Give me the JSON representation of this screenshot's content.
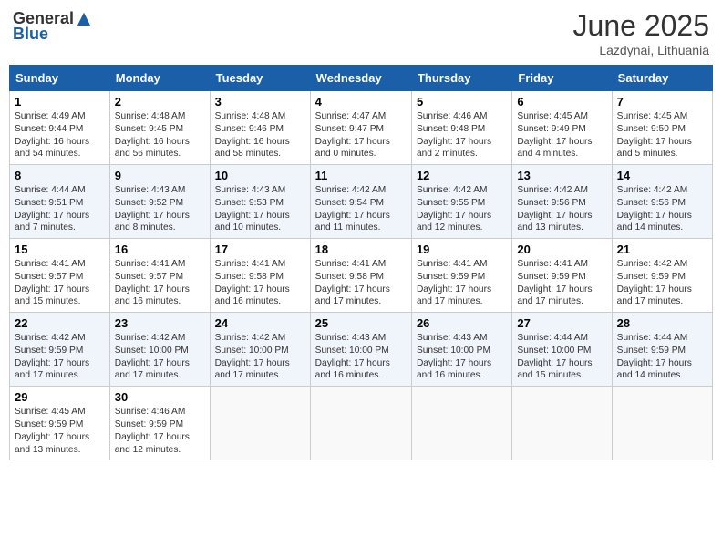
{
  "header": {
    "logo_general": "General",
    "logo_blue": "Blue",
    "month": "June 2025",
    "location": "Lazdynai, Lithuania"
  },
  "days_of_week": [
    "Sunday",
    "Monday",
    "Tuesday",
    "Wednesday",
    "Thursday",
    "Friday",
    "Saturday"
  ],
  "weeks": [
    [
      {
        "day": "1",
        "lines": [
          "Sunrise: 4:49 AM",
          "Sunset: 9:44 PM",
          "Daylight: 16 hours",
          "and 54 minutes."
        ]
      },
      {
        "day": "2",
        "lines": [
          "Sunrise: 4:48 AM",
          "Sunset: 9:45 PM",
          "Daylight: 16 hours",
          "and 56 minutes."
        ]
      },
      {
        "day": "3",
        "lines": [
          "Sunrise: 4:48 AM",
          "Sunset: 9:46 PM",
          "Daylight: 16 hours",
          "and 58 minutes."
        ]
      },
      {
        "day": "4",
        "lines": [
          "Sunrise: 4:47 AM",
          "Sunset: 9:47 PM",
          "Daylight: 17 hours",
          "and 0 minutes."
        ]
      },
      {
        "day": "5",
        "lines": [
          "Sunrise: 4:46 AM",
          "Sunset: 9:48 PM",
          "Daylight: 17 hours",
          "and 2 minutes."
        ]
      },
      {
        "day": "6",
        "lines": [
          "Sunrise: 4:45 AM",
          "Sunset: 9:49 PM",
          "Daylight: 17 hours",
          "and 4 minutes."
        ]
      },
      {
        "day": "7",
        "lines": [
          "Sunrise: 4:45 AM",
          "Sunset: 9:50 PM",
          "Daylight: 17 hours",
          "and 5 minutes."
        ]
      }
    ],
    [
      {
        "day": "8",
        "lines": [
          "Sunrise: 4:44 AM",
          "Sunset: 9:51 PM",
          "Daylight: 17 hours",
          "and 7 minutes."
        ]
      },
      {
        "day": "9",
        "lines": [
          "Sunrise: 4:43 AM",
          "Sunset: 9:52 PM",
          "Daylight: 17 hours",
          "and 8 minutes."
        ]
      },
      {
        "day": "10",
        "lines": [
          "Sunrise: 4:43 AM",
          "Sunset: 9:53 PM",
          "Daylight: 17 hours",
          "and 10 minutes."
        ]
      },
      {
        "day": "11",
        "lines": [
          "Sunrise: 4:42 AM",
          "Sunset: 9:54 PM",
          "Daylight: 17 hours",
          "and 11 minutes."
        ]
      },
      {
        "day": "12",
        "lines": [
          "Sunrise: 4:42 AM",
          "Sunset: 9:55 PM",
          "Daylight: 17 hours",
          "and 12 minutes."
        ]
      },
      {
        "day": "13",
        "lines": [
          "Sunrise: 4:42 AM",
          "Sunset: 9:56 PM",
          "Daylight: 17 hours",
          "and 13 minutes."
        ]
      },
      {
        "day": "14",
        "lines": [
          "Sunrise: 4:42 AM",
          "Sunset: 9:56 PM",
          "Daylight: 17 hours",
          "and 14 minutes."
        ]
      }
    ],
    [
      {
        "day": "15",
        "lines": [
          "Sunrise: 4:41 AM",
          "Sunset: 9:57 PM",
          "Daylight: 17 hours",
          "and 15 minutes."
        ]
      },
      {
        "day": "16",
        "lines": [
          "Sunrise: 4:41 AM",
          "Sunset: 9:57 PM",
          "Daylight: 17 hours",
          "and 16 minutes."
        ]
      },
      {
        "day": "17",
        "lines": [
          "Sunrise: 4:41 AM",
          "Sunset: 9:58 PM",
          "Daylight: 17 hours",
          "and 16 minutes."
        ]
      },
      {
        "day": "18",
        "lines": [
          "Sunrise: 4:41 AM",
          "Sunset: 9:58 PM",
          "Daylight: 17 hours",
          "and 17 minutes."
        ]
      },
      {
        "day": "19",
        "lines": [
          "Sunrise: 4:41 AM",
          "Sunset: 9:59 PM",
          "Daylight: 17 hours",
          "and 17 minutes."
        ]
      },
      {
        "day": "20",
        "lines": [
          "Sunrise: 4:41 AM",
          "Sunset: 9:59 PM",
          "Daylight: 17 hours",
          "and 17 minutes."
        ]
      },
      {
        "day": "21",
        "lines": [
          "Sunrise: 4:42 AM",
          "Sunset: 9:59 PM",
          "Daylight: 17 hours",
          "and 17 minutes."
        ]
      }
    ],
    [
      {
        "day": "22",
        "lines": [
          "Sunrise: 4:42 AM",
          "Sunset: 9:59 PM",
          "Daylight: 17 hours",
          "and 17 minutes."
        ]
      },
      {
        "day": "23",
        "lines": [
          "Sunrise: 4:42 AM",
          "Sunset: 10:00 PM",
          "Daylight: 17 hours",
          "and 17 minutes."
        ]
      },
      {
        "day": "24",
        "lines": [
          "Sunrise: 4:42 AM",
          "Sunset: 10:00 PM",
          "Daylight: 17 hours",
          "and 17 minutes."
        ]
      },
      {
        "day": "25",
        "lines": [
          "Sunrise: 4:43 AM",
          "Sunset: 10:00 PM",
          "Daylight: 17 hours",
          "and 16 minutes."
        ]
      },
      {
        "day": "26",
        "lines": [
          "Sunrise: 4:43 AM",
          "Sunset: 10:00 PM",
          "Daylight: 17 hours",
          "and 16 minutes."
        ]
      },
      {
        "day": "27",
        "lines": [
          "Sunrise: 4:44 AM",
          "Sunset: 10:00 PM",
          "Daylight: 17 hours",
          "and 15 minutes."
        ]
      },
      {
        "day": "28",
        "lines": [
          "Sunrise: 4:44 AM",
          "Sunset: 9:59 PM",
          "Daylight: 17 hours",
          "and 14 minutes."
        ]
      }
    ],
    [
      {
        "day": "29",
        "lines": [
          "Sunrise: 4:45 AM",
          "Sunset: 9:59 PM",
          "Daylight: 17 hours",
          "and 13 minutes."
        ]
      },
      {
        "day": "30",
        "lines": [
          "Sunrise: 4:46 AM",
          "Sunset: 9:59 PM",
          "Daylight: 17 hours",
          "and 12 minutes."
        ]
      },
      null,
      null,
      null,
      null,
      null
    ]
  ]
}
